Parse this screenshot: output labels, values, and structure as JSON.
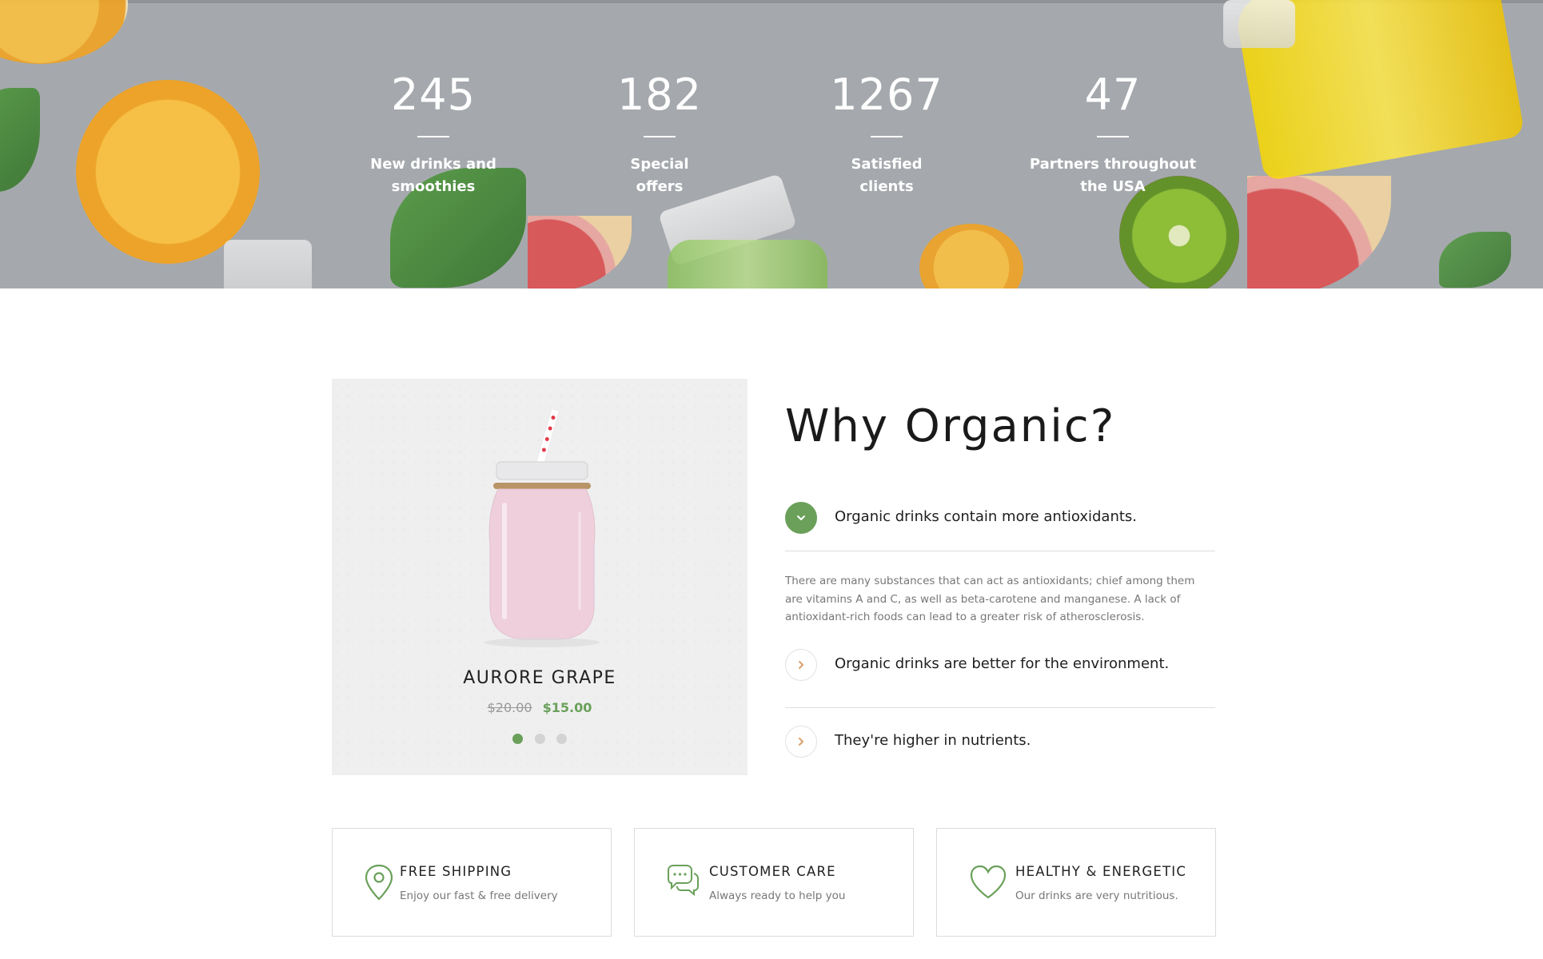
{
  "stats": [
    {
      "number": "245",
      "label_line1": "New drinks and",
      "label_line2": "smoothies"
    },
    {
      "number": "182",
      "label_line1": "Special",
      "label_line2": "offers"
    },
    {
      "number": "1267",
      "label_line1": "Satisfied",
      "label_line2": "clients"
    },
    {
      "number": "47",
      "label_line1": "Partners throughout",
      "label_line2": "the USA"
    }
  ],
  "product": {
    "name": "AURORE GRAPE",
    "old_price": "$20.00",
    "new_price": "$15.00",
    "slide_count": 3,
    "active_slide": 1
  },
  "why": {
    "heading": "Why Organic?",
    "items": [
      {
        "title": "Organic drinks contain more antioxidants.",
        "expanded": true,
        "body": "There are many substances that can act as antioxidants; chief among them are vitamins A and C, as well as beta-carotene and manganese. A lack of antioxidant-rich foods can lead to a greater risk of atherosclerosis."
      },
      {
        "title": "Organic drinks are better for the environment.",
        "expanded": false
      },
      {
        "title": "They're higher in nutrients.",
        "expanded": false
      }
    ]
  },
  "features": [
    {
      "icon": "map-pin-icon",
      "title": "FREE SHIPPING",
      "subtitle": "Enjoy our fast & free delivery"
    },
    {
      "icon": "chat-bubbles-icon",
      "title": "CUSTOMER CARE",
      "subtitle": "Always ready to help you"
    },
    {
      "icon": "heart-icon",
      "title": "HEALTHY & ENERGETIC",
      "subtitle": "Our drinks are very nutritious."
    }
  ],
  "colors": {
    "accent_green": "#6aa05a",
    "hero_overlay": "#a5a9ad",
    "chevron_orange": "#d9a06a"
  }
}
